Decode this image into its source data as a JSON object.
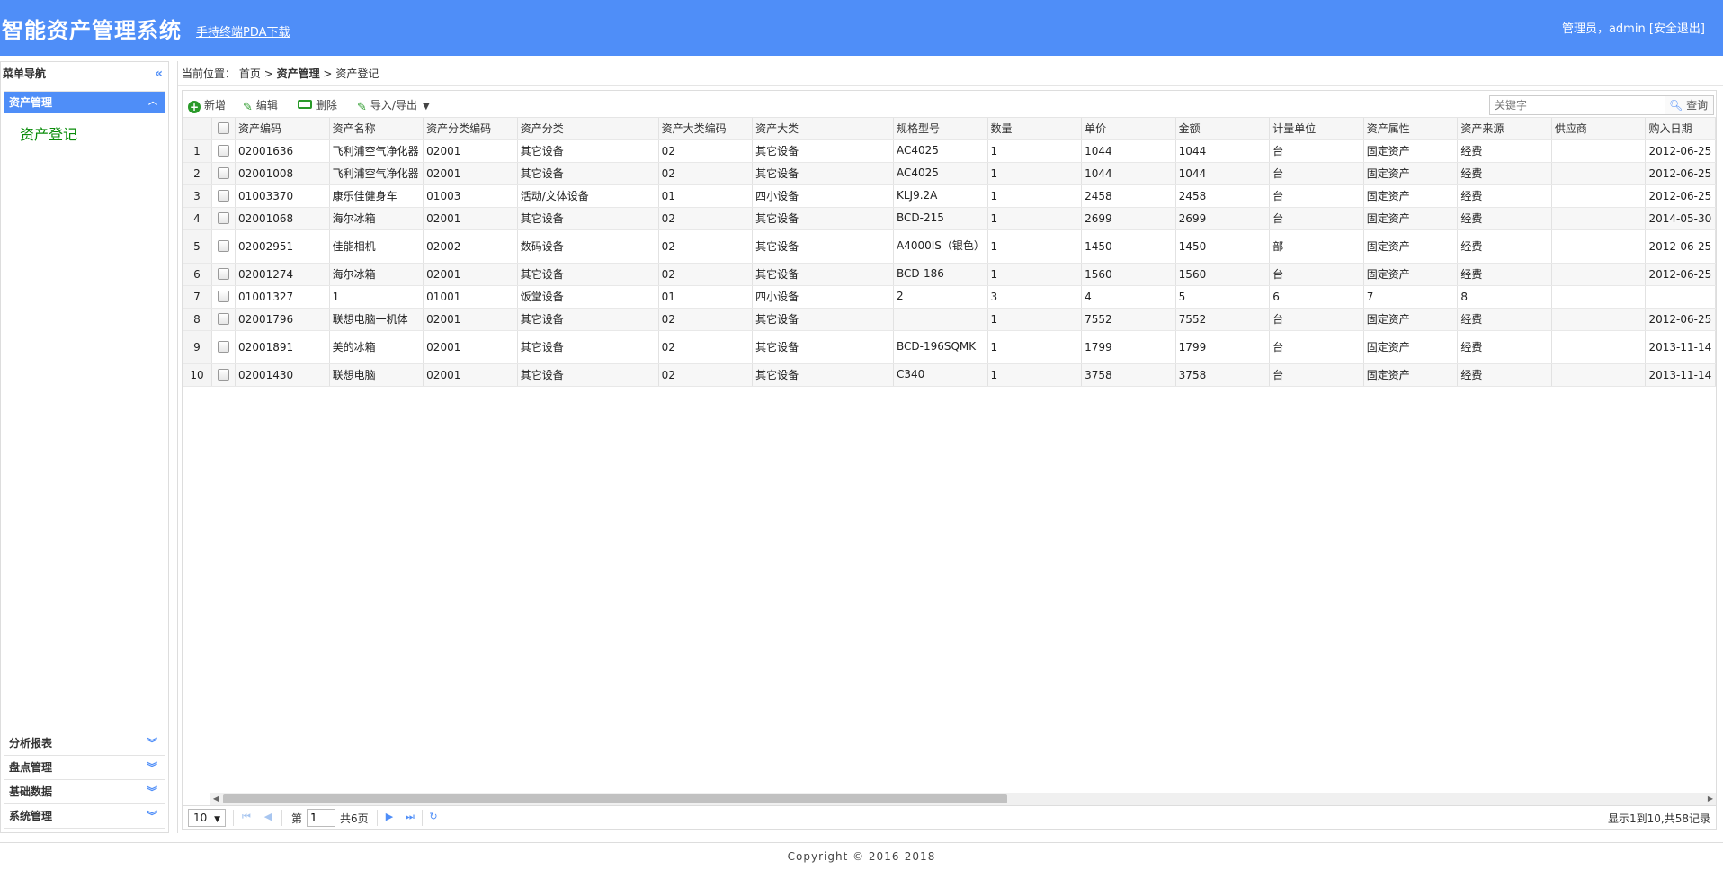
{
  "header": {
    "title": "智能资产管理系统",
    "pda_link": "手持终端PDA下载",
    "user_prefix": "管理员，admin ",
    "logout": "[安全退出]"
  },
  "sidebar": {
    "title": "菜单导航",
    "open_section": "资产管理",
    "open_items": [
      "资产登记"
    ],
    "sections": [
      "分析报表",
      "盘点管理",
      "基础数据",
      "系统管理"
    ]
  },
  "breadcrumb": {
    "prefix": "当前位置：",
    "home": "首页",
    "sep": ">",
    "section": "资产管理",
    "page": "资产登记"
  },
  "toolbar": {
    "add": "新增",
    "edit": "编辑",
    "delete": "删除",
    "import_export": "导入/导出",
    "search_placeholder": "关键字",
    "search_button": "查询"
  },
  "table": {
    "columns": [
      "资产编码",
      "资产名称",
      "资产分类编码",
      "资产分类",
      "资产大类编码",
      "资产大类",
      "规格型号",
      "数量",
      "单价",
      "金额",
      "计量单位",
      "资产属性",
      "资产来源",
      "供应商",
      "购入日期"
    ],
    "rows": [
      {
        "n": "1",
        "cells": [
          "02001636",
          "飞利浦空气净化器",
          "02001",
          "其它设备",
          "02",
          "其它设备",
          "AC4025",
          "1",
          "1044",
          "1044",
          "台",
          "固定资产",
          "经费",
          "",
          "2012-06-25"
        ]
      },
      {
        "n": "2",
        "cells": [
          "02001008",
          "飞利浦空气净化器",
          "02001",
          "其它设备",
          "02",
          "其它设备",
          "AC4025",
          "1",
          "1044",
          "1044",
          "台",
          "固定资产",
          "经费",
          "",
          "2012-06-25"
        ]
      },
      {
        "n": "3",
        "cells": [
          "01003370",
          "康乐佳健身车",
          "01003",
          "活动/文体设备",
          "01",
          "四小设备",
          "KLJ9.2A",
          "1",
          "2458",
          "2458",
          "台",
          "固定资产",
          "经费",
          "",
          "2012-06-25"
        ]
      },
      {
        "n": "4",
        "cells": [
          "02001068",
          "海尔冰箱",
          "02001",
          "其它设备",
          "02",
          "其它设备",
          "BCD-215",
          "1",
          "2699",
          "2699",
          "台",
          "固定资产",
          "经费",
          "",
          "2014-05-30"
        ]
      },
      {
        "n": "5",
        "cells": [
          "02002951",
          "佳能相机",
          "02002",
          "数码设备",
          "02",
          "其它设备",
          "A4000IS（银色）",
          "1",
          "1450",
          "1450",
          "部",
          "固定资产",
          "经费",
          "",
          "2012-06-25"
        ]
      },
      {
        "n": "6",
        "cells": [
          "02001274",
          "海尔冰箱",
          "02001",
          "其它设备",
          "02",
          "其它设备",
          "BCD-186",
          "1",
          "1560",
          "1560",
          "台",
          "固定资产",
          "经费",
          "",
          "2012-06-25"
        ]
      },
      {
        "n": "7",
        "cells": [
          "01001327",
          "1",
          "01001",
          "饭堂设备",
          "01",
          "四小设备",
          "2",
          "3",
          "4",
          "5",
          "6",
          "7",
          "8",
          "",
          ""
        ]
      },
      {
        "n": "8",
        "cells": [
          "02001796",
          "联想电脑一机体",
          "02001",
          "其它设备",
          "02",
          "其它设备",
          "",
          "1",
          "7552",
          "7552",
          "台",
          "固定资产",
          "经费",
          "",
          "2012-06-25"
        ]
      },
      {
        "n": "9",
        "cells": [
          "02001891",
          "美的冰箱",
          "02001",
          "其它设备",
          "02",
          "其它设备",
          "BCD-196SQMK",
          "1",
          "1799",
          "1799",
          "台",
          "固定资产",
          "经费",
          "",
          "2013-11-14"
        ]
      },
      {
        "n": "10",
        "cells": [
          "02001430",
          "联想电脑",
          "02001",
          "其它设备",
          "02",
          "其它设备",
          "C340",
          "1",
          "3758",
          "3758",
          "台",
          "固定资产",
          "经费",
          "",
          "2013-11-14"
        ]
      }
    ]
  },
  "pager": {
    "page_size": "10",
    "page_label": "第",
    "page_value": "1",
    "total_pages": "共6页",
    "info": "显示1到10,共58记录"
  },
  "footer": {
    "copyright": "Copyright © 2016-2018"
  }
}
